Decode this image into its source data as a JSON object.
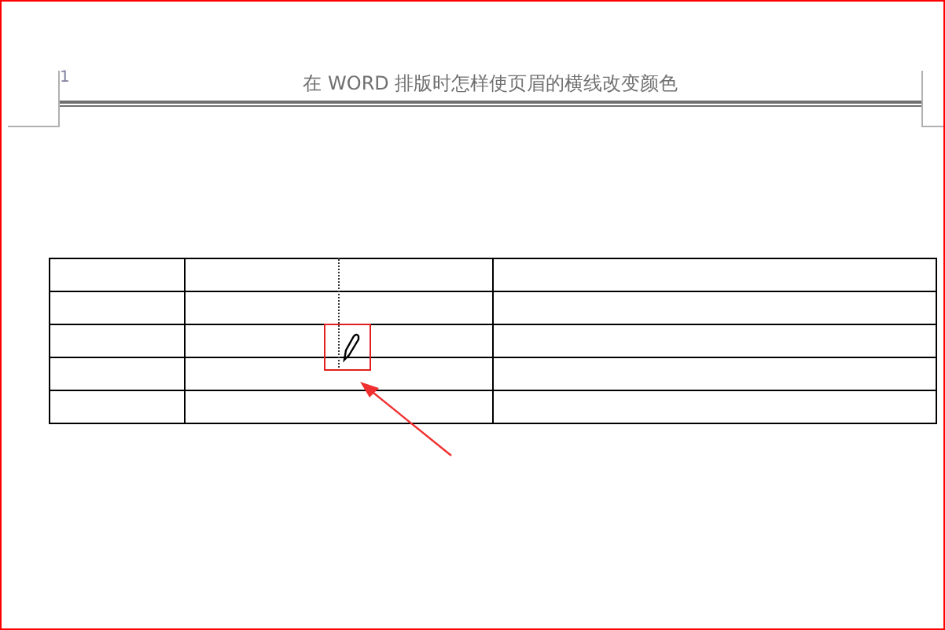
{
  "header": {
    "page_number": "1",
    "title": "在 WORD 排版时怎样使页眉的横线改变颜色"
  }
}
